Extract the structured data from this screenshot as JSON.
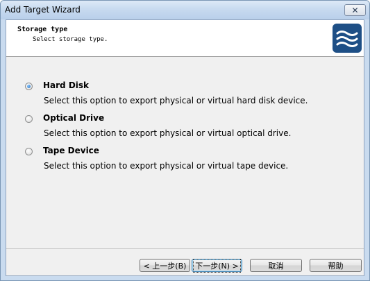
{
  "window": {
    "title": "Add Target Wizard"
  },
  "header": {
    "title": "Storage type",
    "subtitle": "Select storage type."
  },
  "options": [
    {
      "label": "Hard Disk",
      "description": "Select this option to export physical or virtual hard disk device.",
      "selected": true
    },
    {
      "label": "Optical Drive",
      "description": "Select this option to export physical or virtual optical drive.",
      "selected": false
    },
    {
      "label": "Tape Device",
      "description": "Select this option to export physical or virtual tape device.",
      "selected": false
    }
  ],
  "buttons": {
    "back": "< 上一步(B)",
    "next": "下一步(N) >",
    "cancel": "取消",
    "help": "帮助"
  },
  "icons": {
    "close": "close-icon",
    "logo": "waves-logo-icon"
  },
  "colors": {
    "logo_background": "#1e4f86",
    "selected_radio": "#1f6ab8"
  }
}
